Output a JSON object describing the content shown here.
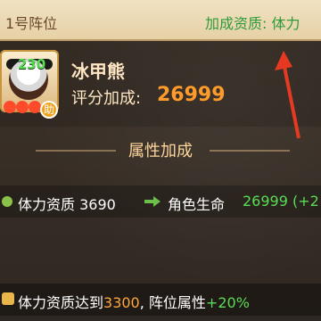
{
  "header": {
    "formation_title": "1号阵位",
    "bonus_quality_label": "加成资质: 体力"
  },
  "hero": {
    "name": "冰甲熊",
    "level": "230",
    "helper_badge": "助",
    "score_label": "评分加成:",
    "score_value": "26999"
  },
  "section": {
    "title": "属性加成"
  },
  "stat_row": {
    "label": "体力资质 3690",
    "target_label": "角色生命",
    "target_value": "26999 (+2"
  },
  "bonus_row": {
    "prefix": "体力资质达到",
    "threshold": "3300",
    "middle": ", 阵位属性",
    "percent": "+20%"
  },
  "colors": {
    "accent_orange": "#ff9b2a",
    "accent_green": "#5bdc55",
    "header_bg": "#f1e2c3",
    "arrow_red": "#e53a21"
  }
}
